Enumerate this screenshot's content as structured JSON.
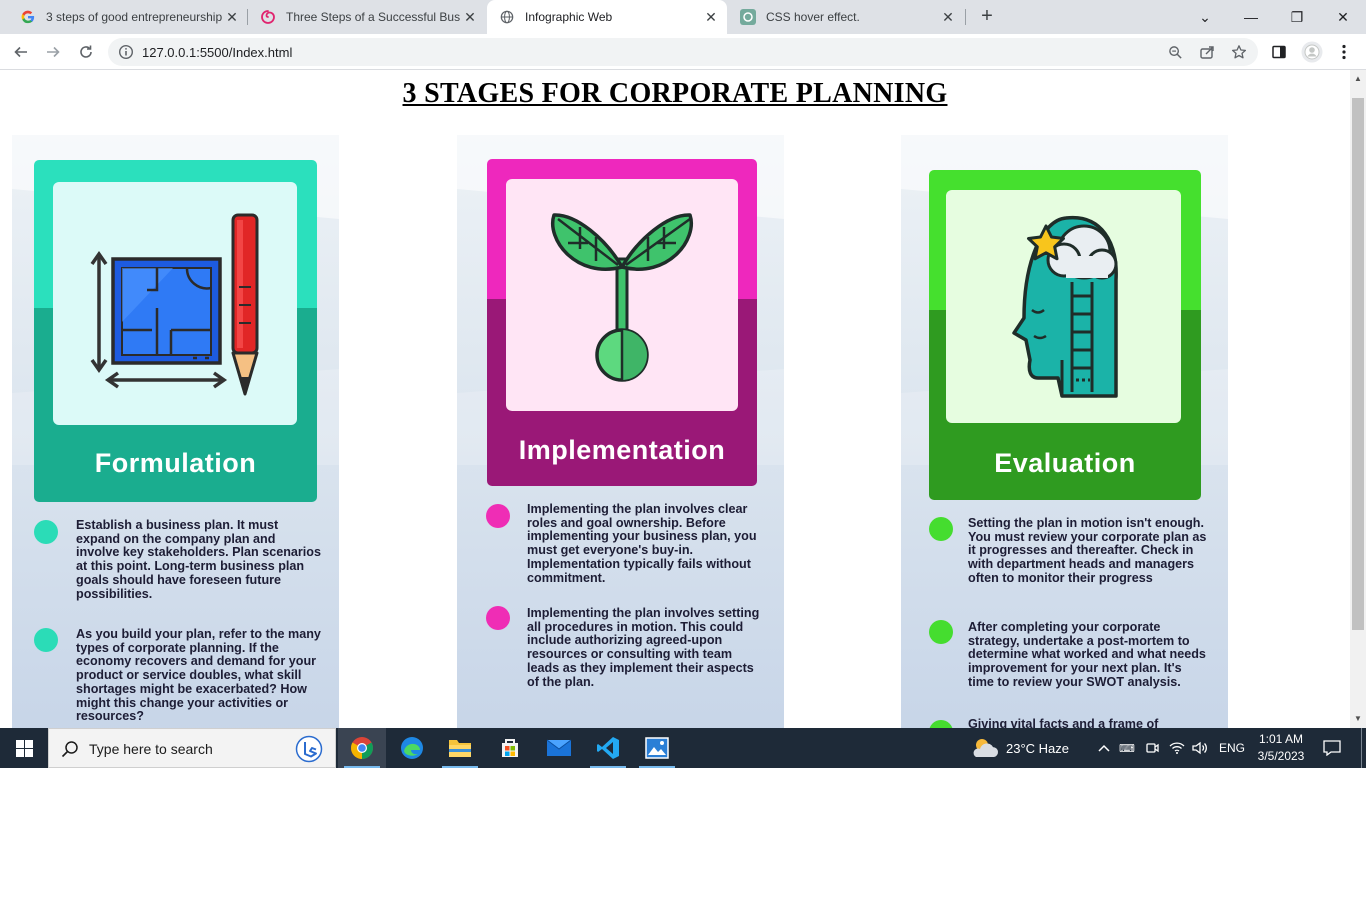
{
  "browser": {
    "tabs": [
      {
        "title": "3 steps of good entrepreneurship",
        "icon": "google-icon",
        "active": false
      },
      {
        "title": "Three Steps of a Successful Busin",
        "icon": "spiral-icon",
        "active": false
      },
      {
        "title": "Infographic Web",
        "icon": "globe-icon",
        "active": true
      },
      {
        "title": "CSS hover effect.",
        "icon": "chatgpt-icon",
        "active": false
      }
    ],
    "url": "127.0.0.1:5500/Index.html"
  },
  "page": {
    "title": "3 STAGES FOR CORPORATE PLANNING",
    "stages": [
      {
        "label": "Formulation",
        "icon": "blueprint-pencil-icon",
        "colors": {
          "top": "#2be0bd",
          "bottom": "#1aad8f",
          "panel": "#dcfaf8",
          "bullet": "#2bdcb7"
        },
        "points": [
          "Establish a business plan. It must expand on the company plan and involve key stakeholders. Plan scenarios at this point. Long-term business plan goals should have foreseen future possibilities.",
          "As you build your plan, refer to the many types of corporate planning. If the economy recovers and demand for your product or service doubles, what skill shortages might be exacerbated? How might this change your activities or resources?"
        ]
      },
      {
        "label": "Implementation",
        "icon": "sprout-icon",
        "colors": {
          "top": "#ee28bd",
          "bottom": "#9a1877",
          "panel": "#ffe5f5",
          "bullet": "#ef2db5"
        },
        "points": [
          "Implementing the plan involves clear roles and goal ownership. Before implementing your business plan, you must get everyone's buy-in. Implementation typically fails without commitment.",
          "Implementing the plan involves setting all procedures in motion. This could include authorizing agreed-upon resources or consulting with team leads as they implement their aspects of the plan."
        ]
      },
      {
        "label": "Evaluation",
        "icon": "head-ladder-star-icon",
        "colors": {
          "top": "#45e02e",
          "bottom": "#2f9b20",
          "panel": "#e6fde0",
          "bullet": "#45dd2f"
        },
        "points": [
          "Setting the plan in motion isn't enough. You must review your corporate plan as it progresses and thereafter. Check in with department heads and managers often to monitor their progress",
          "After completing your corporate strategy, undertake a post-mortem to determine what worked and what needs improvement for your next plan. It's time to review your SWOT analysis.",
          "Giving vital facts and a frame of"
        ]
      }
    ]
  },
  "taskbar": {
    "search_placeholder": "Type here to search",
    "weather": "23°C  Haze",
    "language": "ENG",
    "time": "1:01 AM",
    "date": "3/5/2023",
    "apps": [
      "chrome-icon",
      "edge-icon",
      "file-explorer-icon",
      "store-icon",
      "mail-icon",
      "vscode-icon",
      "photos-icon"
    ]
  }
}
